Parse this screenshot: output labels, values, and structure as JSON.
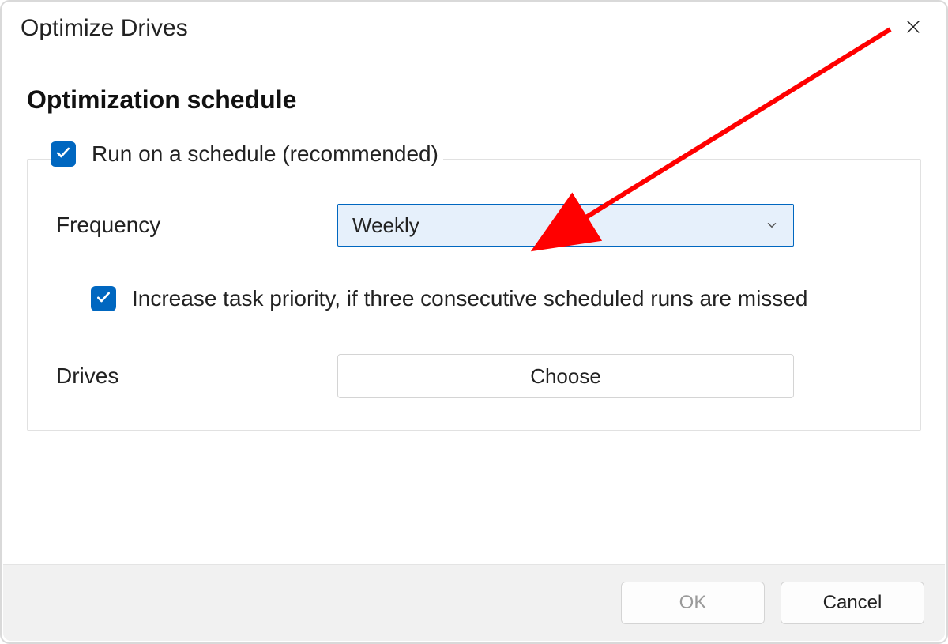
{
  "window": {
    "title": "Optimize Drives"
  },
  "heading": "Optimization schedule",
  "schedule": {
    "run_on_schedule": {
      "checked": true,
      "label": "Run on a schedule (recommended)"
    },
    "frequency": {
      "label": "Frequency",
      "selected": "Weekly"
    },
    "increase_priority": {
      "checked": true,
      "label": "Increase task priority, if three consecutive scheduled runs are missed"
    },
    "drives": {
      "label": "Drives",
      "button_label": "Choose"
    }
  },
  "buttons": {
    "ok": "OK",
    "cancel": "Cancel"
  },
  "annotation": {
    "arrow_target": "frequency-dropdown",
    "color": "#ff0000"
  }
}
